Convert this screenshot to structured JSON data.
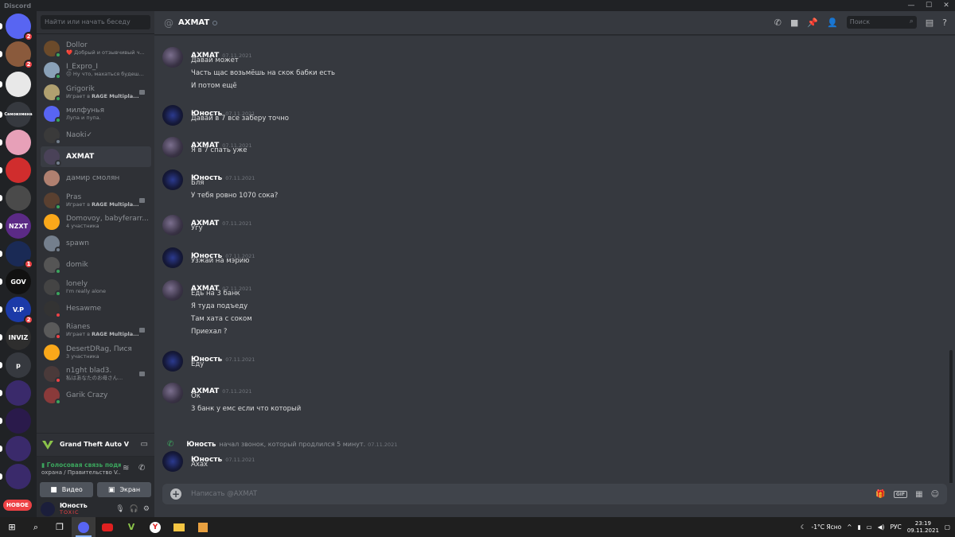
{
  "window": {
    "title": "Discord",
    "controls": [
      "—",
      "☐",
      "✕"
    ]
  },
  "guilds": {
    "items": [
      {
        "label": "",
        "color": "#5865f2",
        "badge": "2"
      },
      {
        "label": "",
        "color": "#8a5a3c",
        "badge": "2"
      },
      {
        "label": "",
        "color": "#e8e8e8",
        "badge": ""
      },
      {
        "label": "Самоизмена",
        "color": "#36393f",
        "badge": ""
      },
      {
        "label": "",
        "color": "#e7a0b8",
        "badge": ""
      },
      {
        "label": "",
        "color": "#d02d2d",
        "badge": ""
      },
      {
        "label": "",
        "color": "#4a4a4a",
        "badge": ""
      },
      {
        "label": "NZXT",
        "color": "#5b2a86",
        "badge": ""
      },
      {
        "label": "",
        "color": "#1a2a55",
        "badge": "1"
      },
      {
        "label": "GOV",
        "color": "#111",
        "badge": ""
      },
      {
        "label": "V.P",
        "color": "#1b3aa8",
        "badge": "2"
      },
      {
        "label": "INVIZ",
        "color": "#2e2e2e",
        "badge": ""
      },
      {
        "label": "p",
        "color": "#36393f",
        "badge": ""
      },
      {
        "label": "",
        "color": "#3a2a6b",
        "badge": ""
      },
      {
        "label": "",
        "color": "#2a1a4b",
        "badge": ""
      },
      {
        "label": "",
        "color": "#3a2a6b",
        "badge": ""
      },
      {
        "label": "",
        "color": "#3a2a6b",
        "badge": ""
      }
    ],
    "new_label": "НОВОЕ"
  },
  "sidebar": {
    "search_placeholder": "Найти или начать беседу",
    "dms": [
      {
        "name": "Dollor",
        "sub": "❤️ Добрый и отзывчивый ч...",
        "sub_bold": "",
        "status": "on",
        "avcolor": "#6b4a2a",
        "game": false
      },
      {
        "name": "I_Expro_I",
        "sub": "😐 Ну что, махаться будеш...",
        "sub_bold": "",
        "status": "on",
        "avcolor": "#8aa1b8",
        "game": false
      },
      {
        "name": "Grigorik",
        "sub": "Играет в ",
        "sub_bold": "RAGE Multipla...",
        "status": "on",
        "avcolor": "#b0a070",
        "game": true
      },
      {
        "name": "милфунья",
        "sub": "Лупа и пупа.",
        "sub_bold": "",
        "status": "on",
        "avcolor": "#5865f2",
        "game": false
      },
      {
        "name": "Naoki✓",
        "sub": "",
        "sub_bold": "",
        "status": "off",
        "avcolor": "#3a3a3a",
        "game": false
      },
      {
        "name": "AXMAT",
        "sub": "",
        "sub_bold": "",
        "status": "off",
        "avcolor": "#4a4258",
        "game": false
      },
      {
        "name": "дамир смолян",
        "sub": "",
        "sub_bold": "",
        "status": "",
        "avcolor": "#b08070",
        "game": false
      },
      {
        "name": "Pras",
        "sub": "Играет в ",
        "sub_bold": "RAGE Multipla...",
        "status": "on",
        "avcolor": "#5a4030",
        "game": true
      },
      {
        "name": "Domovoy, babyferarr...",
        "sub": "4 участника",
        "sub_bold": "",
        "status": "",
        "avcolor": "#faa81a",
        "game": false
      },
      {
        "name": "spawn",
        "sub": "",
        "sub_bold": "",
        "status": "off",
        "avcolor": "#747f8d",
        "game": false
      },
      {
        "name": "domik",
        "sub": "",
        "sub_bold": "",
        "status": "on",
        "avcolor": "#555",
        "game": false
      },
      {
        "name": "lonely",
        "sub": "I'm really alone",
        "sub_bold": "",
        "status": "on",
        "avcolor": "#444",
        "game": false
      },
      {
        "name": "Hesawme",
        "sub": "",
        "sub_bold": "",
        "status": "dnd",
        "avcolor": "#333",
        "game": false
      },
      {
        "name": "Rianes",
        "sub": "Играет в ",
        "sub_bold": "RAGE Multipla...",
        "status": "dnd",
        "avcolor": "#5a5a5a",
        "game": true
      },
      {
        "name": "DesertDRag, Пися",
        "sub": "3 участника",
        "sub_bold": "",
        "status": "",
        "avcolor": "#faa81a",
        "game": false
      },
      {
        "name": "n1ght blad3.",
        "sub": "私はあなたのお母さん...",
        "sub_bold": "",
        "status": "dnd",
        "avcolor": "#4a3a3a",
        "game": true
      },
      {
        "name": "Garik Crazy",
        "sub": "",
        "sub_bold": "",
        "status": "on",
        "avcolor": "#8a3a3a",
        "game": false
      }
    ],
    "activity": {
      "name": "Grand Theft Auto V"
    },
    "voice": {
      "status": "Голосовая связь подк",
      "channel": "охрана / Правительство V...",
      "video_label": "Видео",
      "screen_label": "Экран"
    },
    "user": {
      "name": "Юность",
      "tag": "TOXIC"
    }
  },
  "header": {
    "title": "AXMAT",
    "search_placeholder": "Поиск"
  },
  "messages": [
    {
      "author": "AXMAT",
      "ts": "07.11.2021",
      "av": "axmat",
      "lines": [
        "Давай может",
        "Часть щас возьмёшь на скок бабки есть",
        "И потом ещё"
      ]
    },
    {
      "author": "Юность",
      "ts": "07.11.2021",
      "av": "yun",
      "lines": [
        "Давай в 7 все заберу точно"
      ]
    },
    {
      "author": "AXMAT",
      "ts": "07.11.2021",
      "av": "axmat",
      "lines": [
        "Я в 7 спать уже"
      ]
    },
    {
      "author": "Юность",
      "ts": "07.11.2021",
      "av": "yun",
      "lines": [
        "Бля",
        "У тебя ровно 1070 сока?"
      ]
    },
    {
      "author": "AXMAT",
      "ts": "07.11.2021",
      "av": "axmat",
      "lines": [
        "Угу"
      ]
    },
    {
      "author": "Юность",
      "ts": "07.11.2021",
      "av": "yun",
      "lines": [
        "Узжай на мэрию"
      ]
    },
    {
      "author": "AXMAT",
      "ts": "07.11.2021",
      "av": "axmat",
      "lines": [
        "Едь на 3 банк",
        "Я туда подъеду",
        "Там хата с соком",
        "Приехал ?"
      ]
    },
    {
      "author": "Юность",
      "ts": "07.11.2021",
      "av": "yun",
      "lines": [
        "Еду"
      ]
    },
    {
      "author": "AXMAT",
      "ts": "07.11.2021",
      "av": "axmat",
      "lines": [
        "Ок",
        "3 банк у емс если что который"
      ]
    },
    {
      "author": "Юность",
      "ts": "07.11.2021",
      "av": "yun",
      "lines": [
        "Ахах"
      ]
    }
  ],
  "system_message": {
    "who": "Юность",
    "what": "начал звонок, который продлился 5 минут.",
    "ts": "07.11.2021"
  },
  "composer": {
    "placeholder": "Написать @AXMAT"
  },
  "taskbar": {
    "weather": "-1°C  Ясно",
    "lang": "РУС",
    "time": "23:19",
    "date": "09.11.2021"
  }
}
